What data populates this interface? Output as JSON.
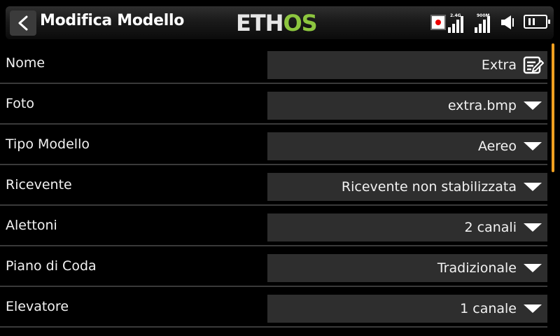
{
  "header": {
    "title": "Modifica Modello",
    "logo_left": "ETH",
    "logo_right": "OS",
    "logo_accent": "#8dc63f",
    "rssi_2g4_label": "2.4G",
    "rssi_900m_label": "900M"
  },
  "rows": [
    {
      "label": "Nome",
      "value": "Extra",
      "control": "edit-icon"
    },
    {
      "label": "Foto",
      "value": "extra.bmp",
      "control": "dropdown"
    },
    {
      "label": "Tipo Modello",
      "value": "Aereo",
      "control": "dropdown"
    },
    {
      "label": "Ricevente",
      "value": "Ricevente non stabilizzata",
      "control": "dropdown"
    },
    {
      "label": "Alettoni",
      "value": "2 canali",
      "control": "dropdown"
    },
    {
      "label": "Piano di Coda",
      "value": "Tradizionale",
      "control": "dropdown"
    },
    {
      "label": "Elevatore",
      "value": "1 canale",
      "control": "dropdown"
    }
  ],
  "colors": {
    "scrollbar": "#f0a020",
    "record_dot": "#e00000"
  }
}
